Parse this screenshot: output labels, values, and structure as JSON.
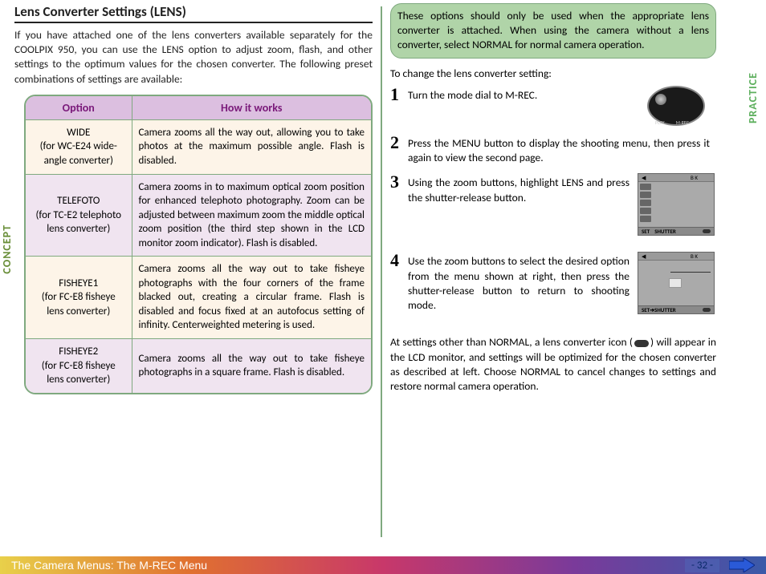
{
  "title": "Lens Converter Settings (LENS)",
  "intro": "If you have attached one of the lens converters available separately for the COOLPIX 950, you can use the LENS option to adjust zoom, flash, and other settings to the optimum values for the chosen converter.  The following preset combinations of settings are available:",
  "table": {
    "headers": [
      "Option",
      "How it works"
    ],
    "rows": [
      {
        "option": "WIDE\n(for WC-E24 wide-angle converter)",
        "desc": "Camera zooms all the way out, allowing you to take photos at the maximum possible angle.  Flash is disabled."
      },
      {
        "option": "TELEFOTO\n(for TC-E2 telephoto lens converter)",
        "desc": "Camera zooms in to maximum optical zoom position for enhanced telephoto photography.  Zoom can be adjusted between maximum zoom the middle optical zoom position (the third step shown in the LCD monitor zoom indicator).  Flash is disabled."
      },
      {
        "option": "FISHEYE1\n(for FC-E8 fisheye lens converter)",
        "desc": "Camera zooms all the way out to take fisheye photographs with the four corners of the frame blacked out, creating a circular frame.  Flash is disabled and focus fixed at an autofocus setting of infinity.  Centerweighted metering is used."
      },
      {
        "option": "FISHEYE2\n(for FC-E8 fisheye lens converter)",
        "desc": "Camera zooms all the way out to take fisheye photographs in a square frame.  Flash is disabled."
      }
    ]
  },
  "note": "These options should only be used when the appropriate lens converter is attached.  When using the camera without a lens converter, select NORMAL for normal camera operation.",
  "lead": "To change the lens converter setting:",
  "steps": [
    {
      "n": "1",
      "t": "Turn the mode dial to M-REC."
    },
    {
      "n": "2",
      "t": "Press the MENU button to display the shooting menu, then press it again to view the second page."
    },
    {
      "n": "3",
      "t": "Using the zoom buttons, highlight LENS and press the shutter-release button."
    },
    {
      "n": "4",
      "t": "Use the zoom buttons to select the desired option from the menu shown at right, then press the shutter-release button to return to shooting mode."
    }
  ],
  "post_a": "At settings other than NORMAL, a lens converter icon (",
  "post_b": ") will appear in the LCD monitor, and settings will be optimized for the chosen converter as described at left.  Choose NORMAL to cancel changes to settings and restore normal camera operation.",
  "lcd": {
    "bk": "B K",
    "set": "SET",
    "shutter": "SHUTTER",
    "arrow_shutter": "SET➔SHUTTER"
  },
  "sidetabs": {
    "left": "CONCEPT",
    "right": "PRACTICE"
  },
  "footer": {
    "path": "The Camera Menus: The M-REC Menu",
    "page": "- 32 -"
  }
}
